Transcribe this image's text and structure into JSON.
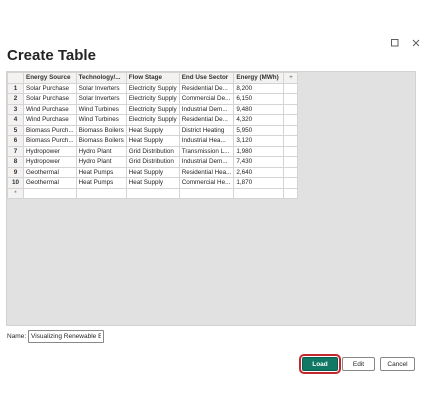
{
  "dialog": {
    "title": "Create Table"
  },
  "window_controls": {
    "maximize_icon": "maximize-icon",
    "close_icon": "close-icon"
  },
  "table": {
    "columns": [
      "Energy Source",
      "Technology/...",
      "Flow Stage",
      "End Use Sector",
      "Energy (MWh)"
    ],
    "add_column_label": "+",
    "add_row_label": "*",
    "rows": [
      {
        "num": "1",
        "cells": [
          "Solar Purchase",
          "Solar Inverters",
          "Electricity Supply",
          "Residential De...",
          "8,200"
        ]
      },
      {
        "num": "2",
        "cells": [
          "Solar Purchase",
          "Solar Inverters",
          "Electricity Supply",
          "Commercial De...",
          "6,150"
        ]
      },
      {
        "num": "3",
        "cells": [
          "Wind Purchase",
          "Wind Turbines",
          "Electricity Supply",
          "Industrial Dem...",
          "9,480"
        ]
      },
      {
        "num": "4",
        "cells": [
          "Wind Purchase",
          "Wind Turbines",
          "Electricity Supply",
          "Residential De...",
          "4,320"
        ]
      },
      {
        "num": "5",
        "cells": [
          "Biomass Purch...",
          "Biomass Boilers",
          "Heat Supply",
          "District Heating",
          "5,950"
        ]
      },
      {
        "num": "6",
        "cells": [
          "Biomass Purch...",
          "Biomass Boilers",
          "Heat Supply",
          "Industrial Hea...",
          "3,120"
        ]
      },
      {
        "num": "7",
        "cells": [
          "Hydropower",
          "Hydro Plant",
          "Grid Distribution",
          "Transmission L...",
          "1,980"
        ]
      },
      {
        "num": "8",
        "cells": [
          "Hydropower",
          "Hydro Plant",
          "Grid Distribution",
          "Industrial Dem...",
          "7,430"
        ]
      },
      {
        "num": "9",
        "cells": [
          "Geothermal",
          "Heat Pumps",
          "Heat Supply",
          "Residential Hea...",
          "2,640"
        ]
      },
      {
        "num": "10",
        "cells": [
          "Geothermal",
          "Heat Pumps",
          "Heat Supply",
          "Commercial He...",
          "1,870"
        ]
      }
    ]
  },
  "name_field": {
    "label": "Name:",
    "value": "Visualizing Renewable Energ"
  },
  "buttons": {
    "load": "Load",
    "edit": "Edit",
    "cancel": "Cancel"
  },
  "colors": {
    "load_button": "#117865",
    "load_focus_outline": "#c4262e"
  }
}
